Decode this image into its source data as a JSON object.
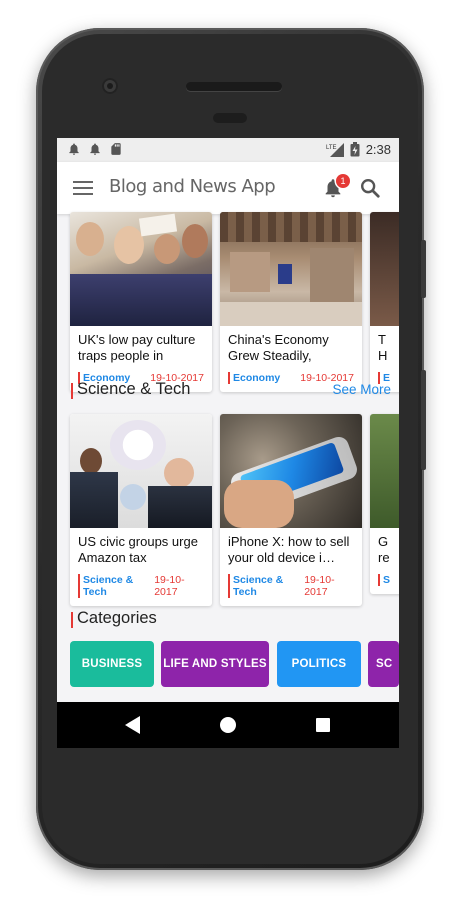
{
  "status_bar": {
    "time": "2:38",
    "network": "LTE",
    "left_icons": [
      "notification-bell-icon",
      "notification-bell-icon",
      "sd-card-icon"
    ]
  },
  "app_bar": {
    "title": "Blog and News App",
    "notification_count": "1"
  },
  "top_row": {
    "cards": [
      {
        "title": "UK's low pay culture traps people in poor…",
        "category": "Economy",
        "date": "19-10-2017"
      },
      {
        "title": "China's Economy Grew Steadily, Than…",
        "category": "Economy",
        "date": "19-10-2017"
      },
      {
        "title": "T H",
        "category": "E",
        "date": ""
      }
    ]
  },
  "science_section": {
    "title": "Science & Tech",
    "see_more": "See More",
    "cards": [
      {
        "title": "US civic groups urge Amazon tax pledge:…",
        "category": "Science & Tech",
        "date": "19-10-2017"
      },
      {
        "title": "iPhone X: how to sell your old device i…",
        "category": "Science & Tech",
        "date": "19-10-2017"
      },
      {
        "title": "G re",
        "category": "S",
        "date": ""
      }
    ]
  },
  "categories_section": {
    "title": "Categories",
    "chips": [
      {
        "label": "BUSINESS",
        "color": "#1abc9c"
      },
      {
        "label": "LIFE AND STYLES",
        "color": "#8e24aa"
      },
      {
        "label": "POLITICS",
        "color": "#2196f3"
      },
      {
        "label": "SC",
        "color": "#8e24aa"
      }
    ]
  },
  "colors": {
    "accent_blue": "#1e88e5",
    "accent_red": "#e53935"
  }
}
